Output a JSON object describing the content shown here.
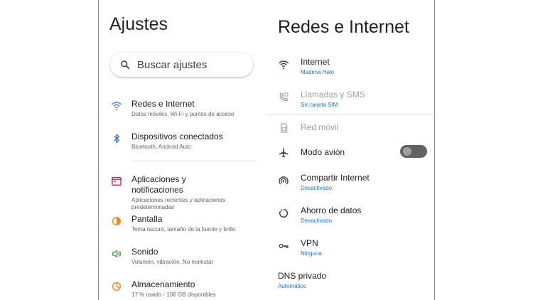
{
  "left": {
    "title": "Ajustes",
    "search": {
      "placeholder": "Buscar ajustes",
      "icon": "search-icon"
    },
    "items": [
      {
        "label": "Redes e Internet",
        "sub": "Datos móviles, Wi-Fi y puntos de acceso",
        "icon": "wifi-icon",
        "color": "#5b7ce6"
      },
      {
        "label": "Dispositivos conectados",
        "sub": "Bluetooth, Android Auto",
        "icon": "bluetooth-icon",
        "color": "#3f6fd8"
      },
      {
        "label": "Aplicaciones y notificaciones",
        "sub": "Aplicaciones recientes y aplicaciones predeterminadas",
        "icon": "apps-icon",
        "color": "#c2185b"
      },
      {
        "label": "Pantalla",
        "sub": "Tema oscuro, tamaño de la fuente y brillo",
        "icon": "brightness-icon",
        "color": "#f08a24"
      },
      {
        "label": "Sonido",
        "sub": "Volumen, vibración, No molestar",
        "icon": "volume-icon",
        "color": "#43a047"
      },
      {
        "label": "Almacenamiento",
        "sub": "17 % usado - 106 GB disponibles",
        "icon": "storage-icon",
        "color": "#f08a24"
      }
    ]
  },
  "right": {
    "title": "Redes e Internet",
    "items": [
      {
        "label": "Internet",
        "sub": "Madima Halo",
        "icon": "wifi-icon",
        "disabled": false
      },
      {
        "label": "Llamadas y SMS",
        "sub": "Sin tarjeta SIM",
        "icon": "calls-icon",
        "disabled": true
      },
      {
        "label": "Red móvil",
        "sub": "",
        "icon": "sim-icon",
        "disabled": true
      },
      {
        "label": "Modo avión",
        "sub": "",
        "icon": "airplane-icon",
        "disabled": false,
        "toggle": false
      },
      {
        "label": "Compartir Internet",
        "sub": "Desactivado",
        "icon": "hotspot-icon",
        "disabled": false
      },
      {
        "label": "Ahorro de datos",
        "sub": "Desactivado",
        "icon": "data-saver-icon",
        "disabled": false
      },
      {
        "label": "VPN",
        "sub": "Ninguna",
        "icon": "vpn-icon",
        "disabled": false
      },
      {
        "label": "DNS privado",
        "sub": "Automático",
        "icon": "",
        "disabled": false
      }
    ]
  },
  "colors": {
    "accent": "#1a73e8",
    "text": "#202124",
    "secondary": "#5f6368",
    "disabled": "#9aa0a6"
  }
}
